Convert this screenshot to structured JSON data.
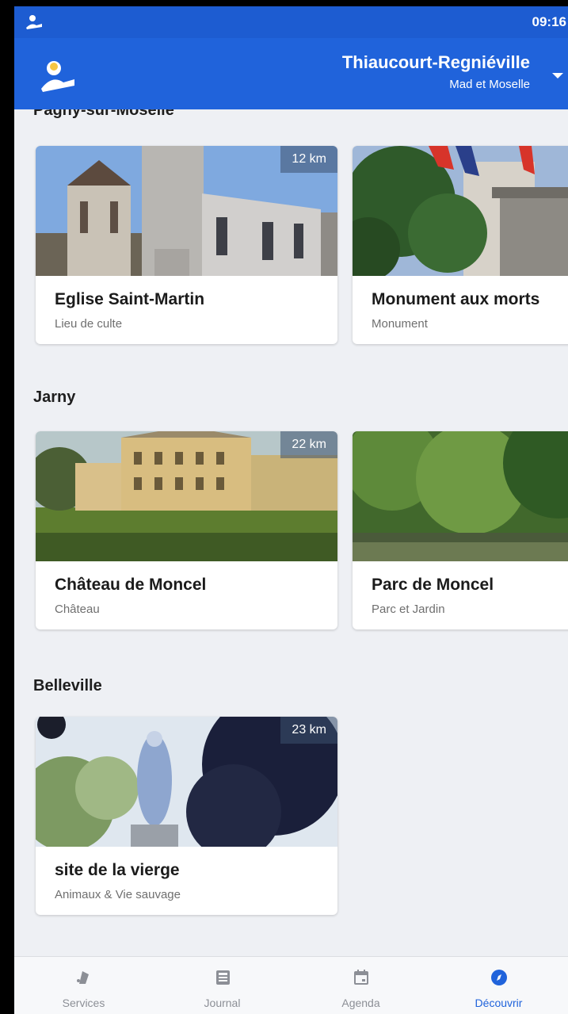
{
  "status_bar": {
    "time": "09:16"
  },
  "header": {
    "town": "Thiaucourt-Regniéville",
    "region": "Mad et Moselle"
  },
  "sections": [
    {
      "title": "Pagny-sur-Moselle",
      "cards": [
        {
          "name": "Eglise Saint-Martin",
          "category": "Lieu de culte",
          "distance": "12 km"
        },
        {
          "name": "Monument aux morts",
          "category": "Monument"
        }
      ]
    },
    {
      "title": "Jarny",
      "cards": [
        {
          "name": "Château de Moncel",
          "category": "Château",
          "distance": "22 km"
        },
        {
          "name": "Parc de Moncel",
          "category": "Parc et Jardin"
        }
      ]
    },
    {
      "title": "Belleville",
      "cards": [
        {
          "name": "site de la vierge",
          "category": "Animaux & Vie sauvage",
          "distance": "23 km"
        }
      ]
    }
  ],
  "bottom_nav": [
    {
      "label": "Services",
      "icon": "services-icon"
    },
    {
      "label": "Journal",
      "icon": "newspaper-icon"
    },
    {
      "label": "Agenda",
      "icon": "calendar-icon"
    },
    {
      "label": "Découvrir",
      "icon": "compass-icon",
      "active": true
    }
  ],
  "colors": {
    "primary": "#2063db",
    "background": "#eef0f4",
    "inactive": "#8c8f96"
  }
}
